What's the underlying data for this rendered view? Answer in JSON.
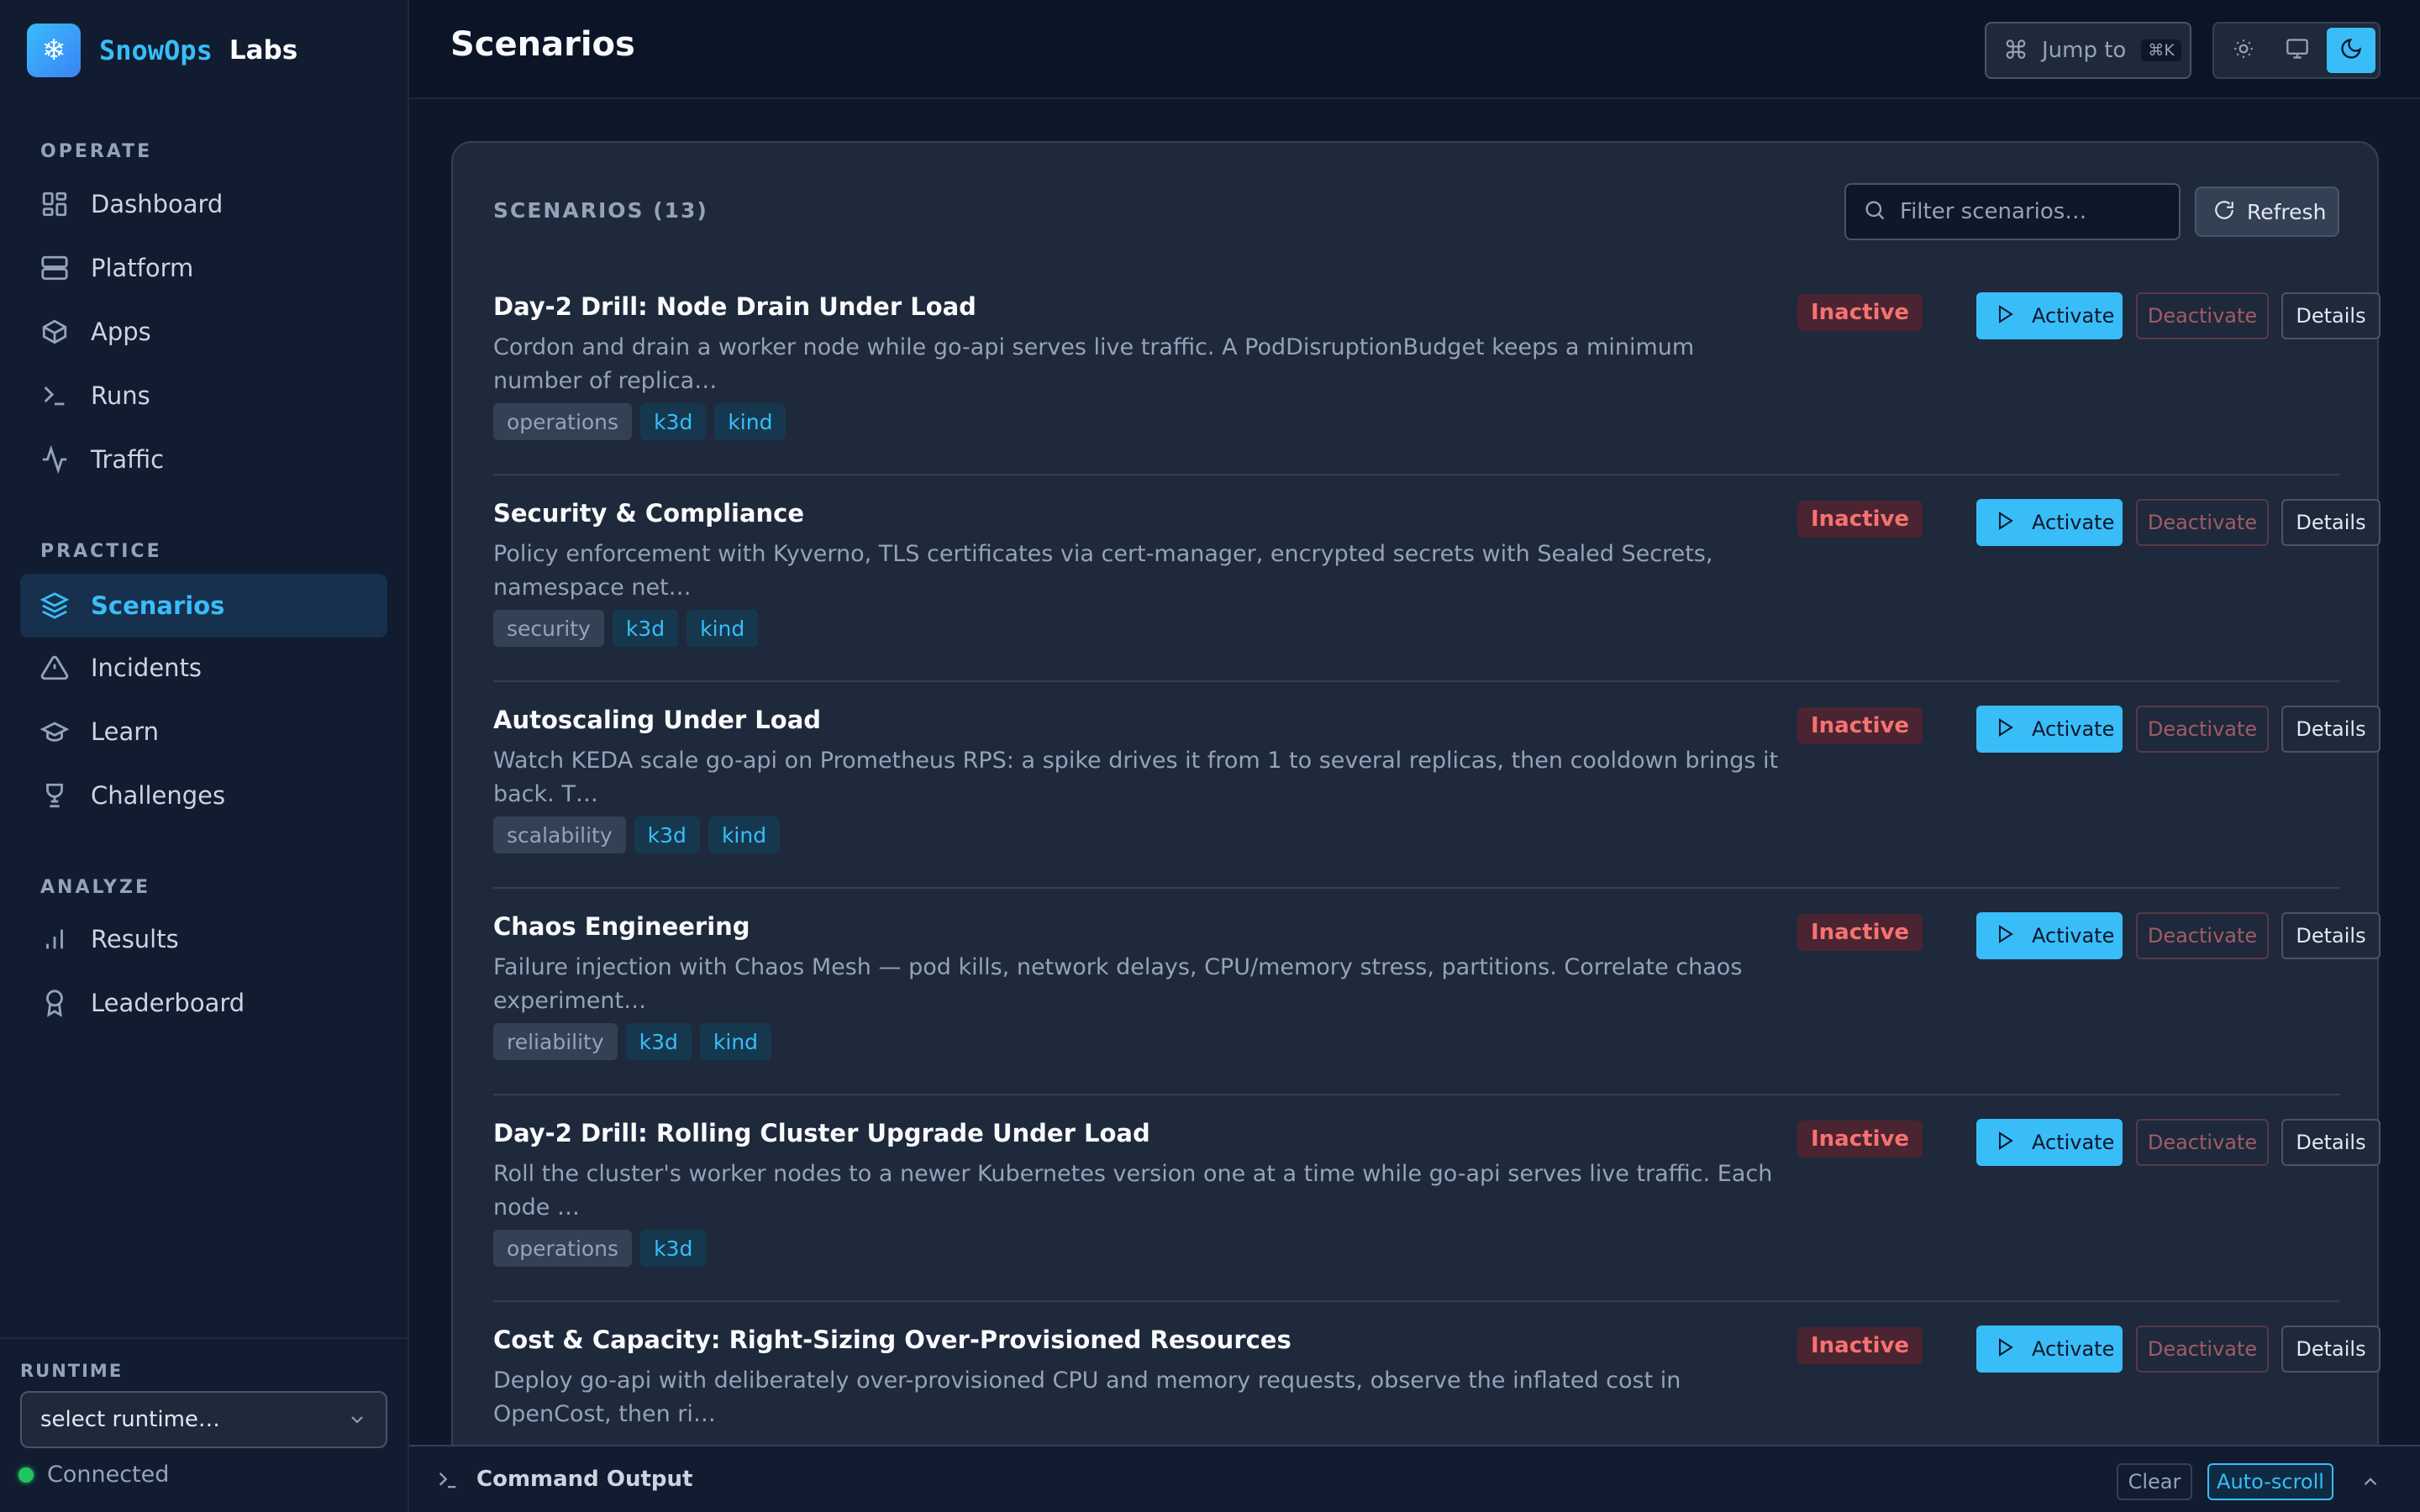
{
  "brand": {
    "name": "SnowOps",
    "sub": "Labs",
    "logo_icon": "snowflake-icon"
  },
  "sidebar": {
    "sections": [
      {
        "title": "OPERATE"
      },
      {
        "title": "PRACTICE"
      },
      {
        "title": "ANALYZE"
      }
    ],
    "items": [
      {
        "label": "Dashboard",
        "icon": "grid-icon"
      },
      {
        "label": "Platform",
        "icon": "server-icon"
      },
      {
        "label": "Apps",
        "icon": "box-icon"
      },
      {
        "label": "Runs",
        "icon": "terminal-icon"
      },
      {
        "label": "Traffic",
        "icon": "activity-icon"
      },
      {
        "label": "Scenarios",
        "icon": "layers-icon",
        "active": true
      },
      {
        "label": "Incidents",
        "icon": "alert-triangle-icon"
      },
      {
        "label": "Learn",
        "icon": "graduation-cap-icon"
      },
      {
        "label": "Challenges",
        "icon": "trophy-icon"
      },
      {
        "label": "Results",
        "icon": "bar-chart-icon"
      },
      {
        "label": "Leaderboard",
        "icon": "award-icon"
      }
    ],
    "runtime": {
      "label": "RUNTIME",
      "selected": "select runtime…"
    },
    "status": {
      "label": "Connected",
      "color": "#22c55e"
    }
  },
  "header": {
    "title": "Scenarios",
    "jump": {
      "label": "Jump to",
      "shortcut": "⌘K"
    }
  },
  "card": {
    "title": "SCENARIOS (13)",
    "filter_placeholder": "Filter scenarios…",
    "refresh_label": "Refresh"
  },
  "actions": {
    "activate": "Activate",
    "deactivate": "Deactivate",
    "details": "Details"
  },
  "scenarios": [
    {
      "title": "Day-2 Drill: Node Drain Under Load",
      "desc": "Cordon and drain a worker node while go-api serves live traffic. A PodDisruptionBudget keeps a minimum number of replica…",
      "tags": [
        {
          "label": "operations",
          "style": "gray"
        },
        {
          "label": "k3d",
          "style": "blue"
        },
        {
          "label": "kind",
          "style": "blue"
        }
      ],
      "status": "Inactive"
    },
    {
      "title": "Security & Compliance",
      "desc": "Policy enforcement with Kyverno, TLS certificates via cert-manager, encrypted secrets with Sealed Secrets, namespace net…",
      "tags": [
        {
          "label": "security",
          "style": "gray"
        },
        {
          "label": "k3d",
          "style": "blue"
        },
        {
          "label": "kind",
          "style": "blue"
        }
      ],
      "status": "Inactive"
    },
    {
      "title": "Autoscaling Under Load",
      "desc": "Watch KEDA scale go-api on Prometheus RPS: a spike drives it from 1 to several replicas, then cooldown brings it back. T…",
      "tags": [
        {
          "label": "scalability",
          "style": "gray"
        },
        {
          "label": "k3d",
          "style": "blue"
        },
        {
          "label": "kind",
          "style": "blue"
        }
      ],
      "status": "Inactive"
    },
    {
      "title": "Chaos Engineering",
      "desc": "Failure injection with Chaos Mesh — pod kills, network delays, CPU/memory stress, partitions. Correlate chaos experiment…",
      "tags": [
        {
          "label": "reliability",
          "style": "gray"
        },
        {
          "label": "k3d",
          "style": "blue"
        },
        {
          "label": "kind",
          "style": "blue"
        }
      ],
      "status": "Inactive"
    },
    {
      "title": "Day-2 Drill: Rolling Cluster Upgrade Under Load",
      "desc": "Roll the cluster's worker nodes to a newer Kubernetes version one at a time while go-api serves live traffic. Each node …",
      "tags": [
        {
          "label": "operations",
          "style": "gray"
        },
        {
          "label": "k3d",
          "style": "blue"
        }
      ],
      "status": "Inactive"
    },
    {
      "title": "Cost & Capacity: Right-Sizing Over-Provisioned Resources",
      "desc": "Deploy go-api with deliberately over-provisioned CPU and memory requests, observe the inflated cost in OpenCost, then ri…",
      "tags": [],
      "status": "Inactive"
    }
  ],
  "command_bar": {
    "label": "Command Output",
    "clear": "Clear",
    "autoscroll": "Auto-scroll"
  },
  "colors": {
    "accent": "#38bdf8",
    "inactive": "#f87171",
    "connected": "#22c55e"
  }
}
